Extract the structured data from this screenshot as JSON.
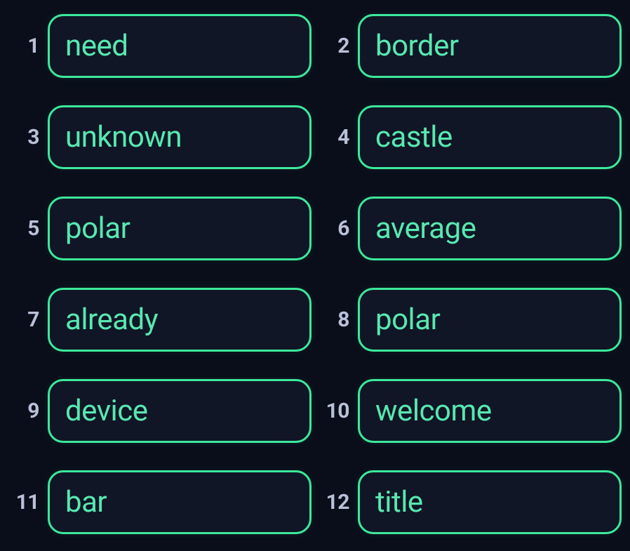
{
  "seed": {
    "words": [
      {
        "index": "1",
        "word": "need"
      },
      {
        "index": "2",
        "word": "border"
      },
      {
        "index": "3",
        "word": "unknown"
      },
      {
        "index": "4",
        "word": "castle"
      },
      {
        "index": "5",
        "word": "polar"
      },
      {
        "index": "6",
        "word": "average"
      },
      {
        "index": "7",
        "word": "already"
      },
      {
        "index": "8",
        "word": "polar"
      },
      {
        "index": "9",
        "word": "device"
      },
      {
        "index": "10",
        "word": "welcome"
      },
      {
        "index": "11",
        "word": "bar"
      },
      {
        "index": "12",
        "word": "title"
      }
    ]
  }
}
